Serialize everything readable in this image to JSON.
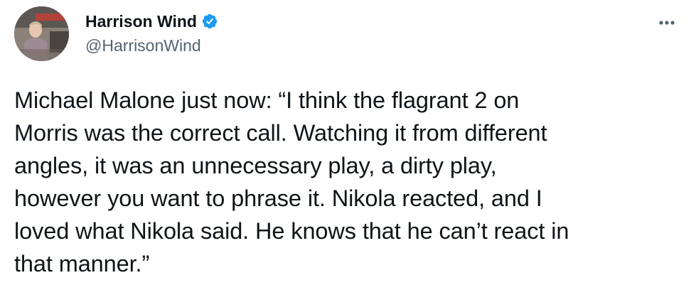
{
  "author": {
    "display_name": "Harrison Wind",
    "handle": "@HarrisonWind",
    "verified": true,
    "avatar_icon": "profile-photo"
  },
  "tweet": {
    "text": "Michael Malone just now: “I think the flagrant 2 on\nMorris was the correct call. Watching it from different\nangles, it was an unnecessary play, a dirty play,\nhowever you want to phrase it. Nikola reacted, and I\nloved what Nikola said. He knows that he can’t react in\nthat manner.”"
  },
  "icons": {
    "verified": "verified-badge-icon",
    "more": "more-options-icon"
  },
  "colors": {
    "verified_blue": "#1d9bf0",
    "text_primary": "#0f1419",
    "text_secondary": "#536471"
  }
}
